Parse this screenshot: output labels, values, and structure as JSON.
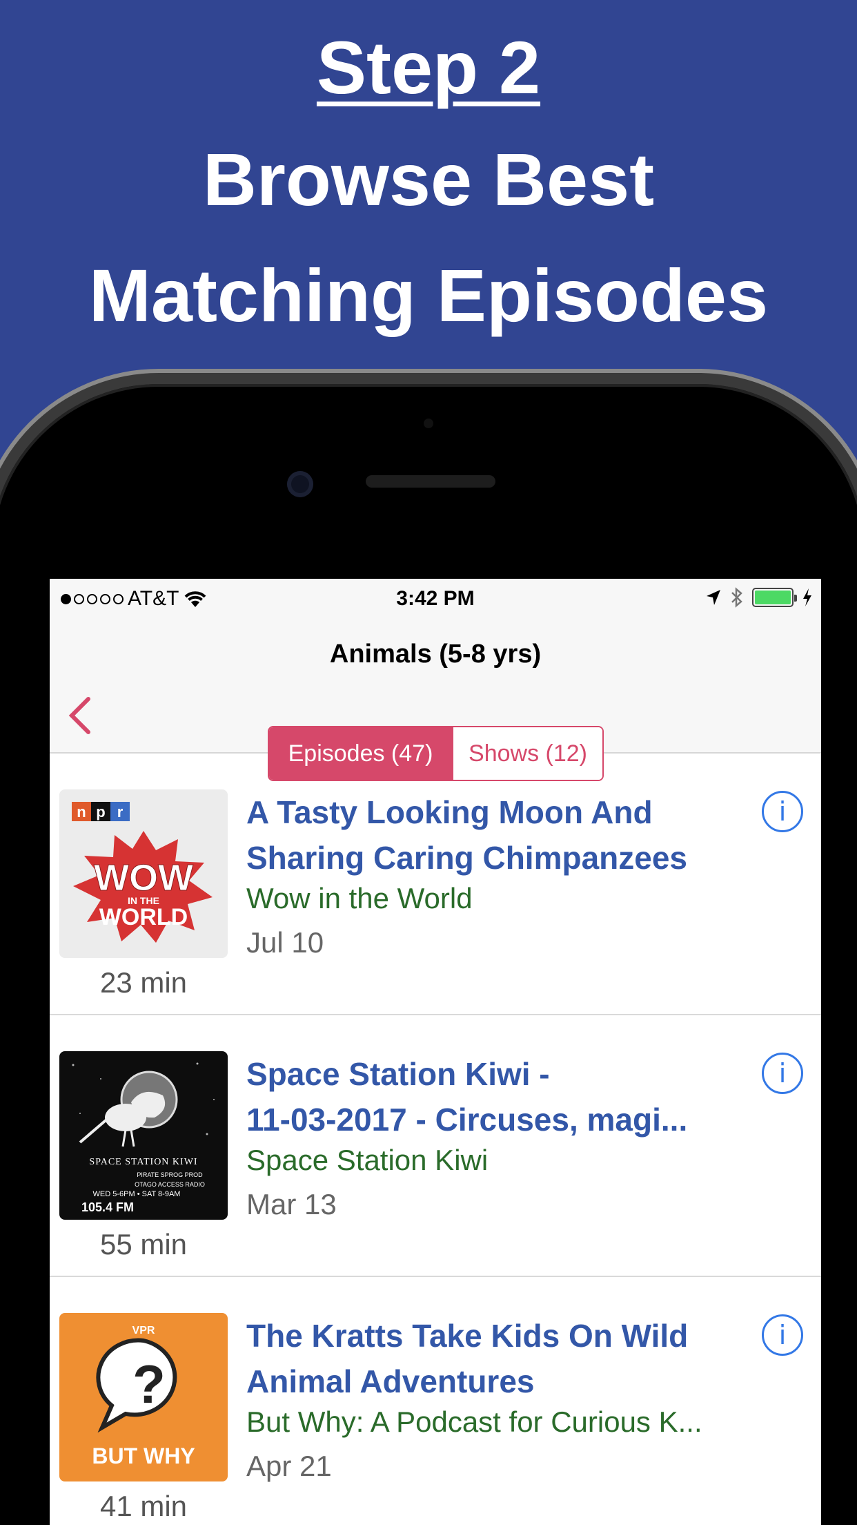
{
  "headline": {
    "step": "Step 2",
    "line1": "Browse Best",
    "line2": "Matching Episodes"
  },
  "colors": {
    "background": "#314592",
    "accent": "#d6486a",
    "episode_title": "#3357a8",
    "show_name": "#2a6b2a",
    "info": "#3378e6"
  },
  "status_bar": {
    "carrier": "AT&T",
    "signal_bars_filled": 1,
    "signal_bars_total": 5,
    "time": "3:42 PM",
    "icons": [
      "wifi-icon",
      "location-arrow-icon",
      "bluetooth-icon",
      "battery-icon",
      "charging-bolt-icon"
    ],
    "battery_level": 1.0
  },
  "nav": {
    "title": "Animals (5-8 yrs)",
    "back_icon": "chevron-left-icon",
    "segments": [
      {
        "label": "Episodes (47)",
        "selected": true
      },
      {
        "label": "Shows (12)",
        "selected": false
      }
    ]
  },
  "episodes": [
    {
      "title_line1": "A Tasty Looking Moon And",
      "title_line2": "Sharing Caring Chimpanzees",
      "show": "Wow in the World",
      "date": "Jul 10",
      "duration": "23 min",
      "art": {
        "badge": "npr",
        "l1": "WOW",
        "l2": "IN THE",
        "l3": "WORLD"
      }
    },
    {
      "title_line1": "Space Station Kiwi -",
      "title_line2": "11-03-2017 - Circuses, magi...",
      "show": "Space Station Kiwi",
      "date": "Mar 13",
      "duration": "55 min",
      "art": {
        "l1": "SPACE STATION KIWI",
        "l2": "PIRATE SPROG PROD",
        "l3": "OTAGO ACCESS RADIO",
        "l4": "WED 5-6PM • SAT 8-9AM",
        "l5": "105.4 FM"
      }
    },
    {
      "title_line1": "The Kratts Take Kids On Wild",
      "title_line2": "Animal Adventures",
      "show": "But Why: A Podcast for Curious K...",
      "date": "Apr 21",
      "duration": "41 min",
      "art": {
        "badge": "VPR",
        "l1": "?",
        "l2": "BUT WHY"
      }
    }
  ]
}
